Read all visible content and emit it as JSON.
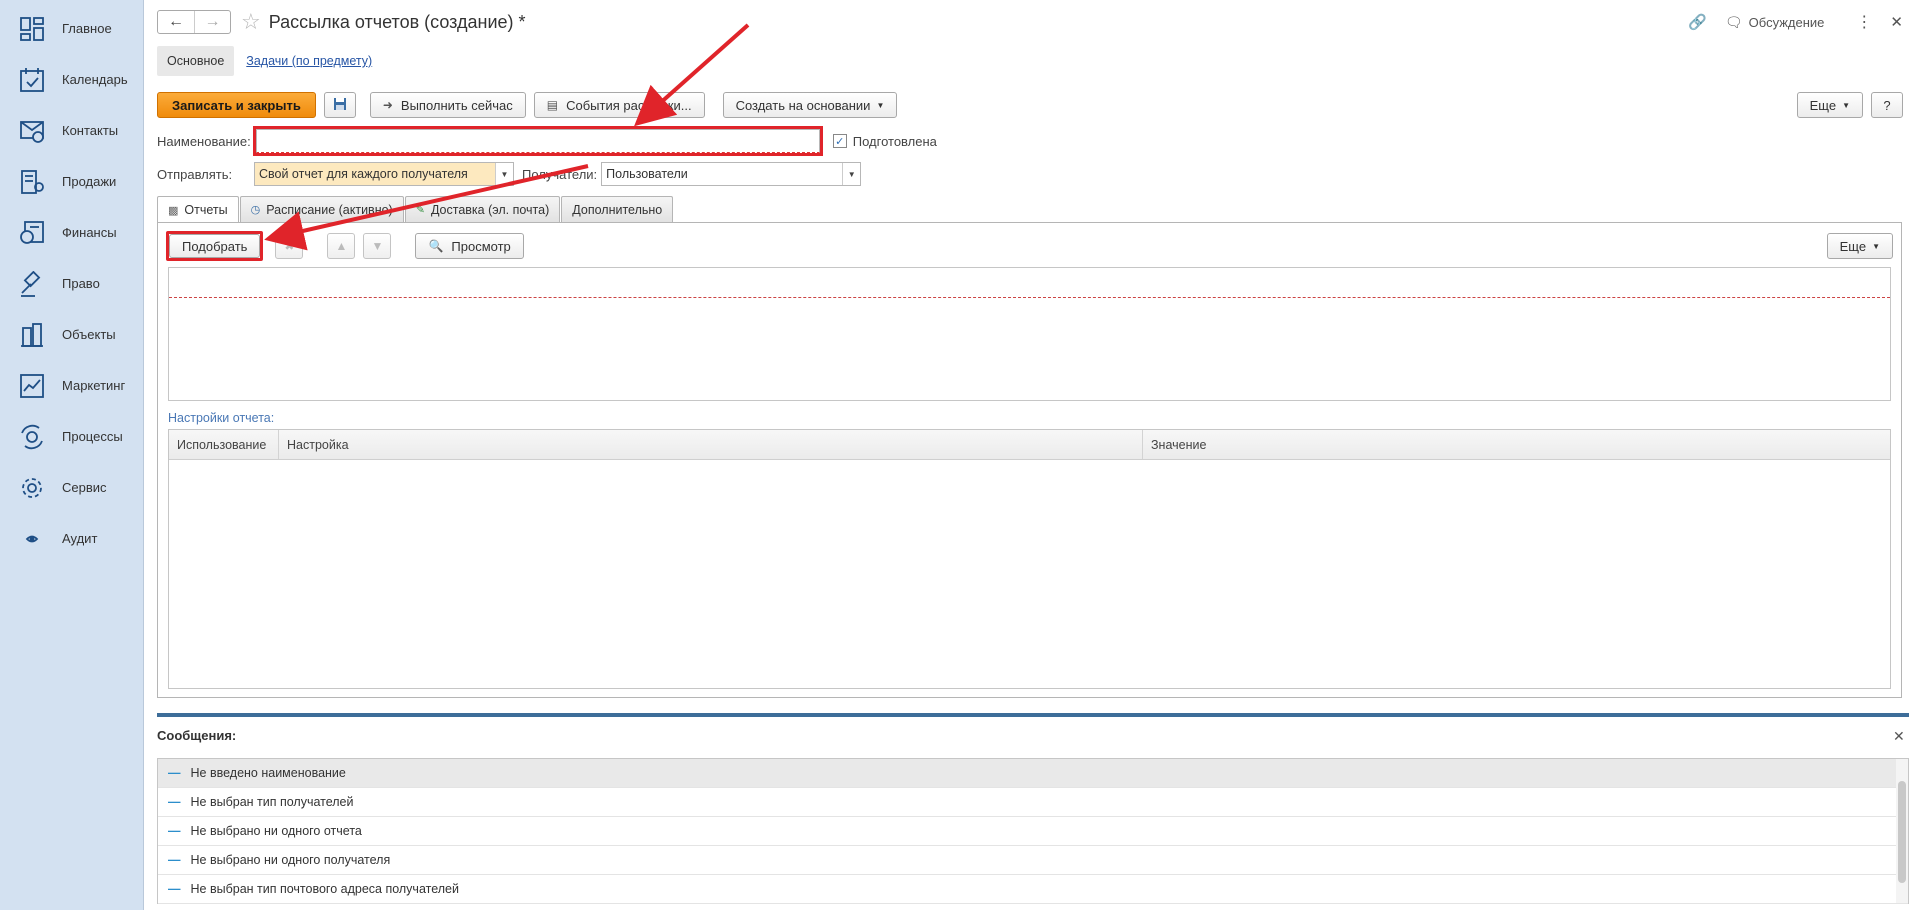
{
  "sidebar": {
    "items": [
      {
        "label": "Главное",
        "icon": "home-grid-icon"
      },
      {
        "label": "Календарь",
        "icon": "calendar-icon"
      },
      {
        "label": "Контакты",
        "icon": "contacts-icon"
      },
      {
        "label": "Продажи",
        "icon": "sales-icon"
      },
      {
        "label": "Финансы",
        "icon": "finance-icon"
      },
      {
        "label": "Право",
        "icon": "law-gavel-icon"
      },
      {
        "label": "Объекты",
        "icon": "buildings-icon"
      },
      {
        "label": "Маркетинг",
        "icon": "chart-icon"
      },
      {
        "label": "Процессы",
        "icon": "process-gears-icon"
      },
      {
        "label": "Сервис",
        "icon": "gear-icon"
      },
      {
        "label": "Аудит",
        "icon": "eye-icon"
      }
    ]
  },
  "header": {
    "title": "Рассылка отчетов (создание) *",
    "discussion": "Обсуждение"
  },
  "formtabs": {
    "main": "Основное",
    "tasks": "Задачи (по предмету)"
  },
  "commands": {
    "save_close": "Записать и закрыть",
    "run_now": "Выполнить сейчас",
    "events": "События рассылки...",
    "create_based": "Создать на основании",
    "more": "Еще",
    "help": "?"
  },
  "form": {
    "name_label": "Наименование:",
    "name_value": "",
    "prepared_label": "Подготовлена",
    "send_label": "Отправлять:",
    "send_value": "Свой отчет для каждого получателя",
    "recipients_label": "Получатели:",
    "recipients_value": "Пользователи"
  },
  "tabs": [
    {
      "label": "Отчеты"
    },
    {
      "label": "Расписание (активно)"
    },
    {
      "label": "Доставка (эл. почта)"
    },
    {
      "label": "Дополнительно"
    }
  ],
  "panel": {
    "pick": "Подобрать",
    "preview": "Просмотр",
    "more": "Еще",
    "settings_label": "Настройки отчета:",
    "columns": [
      "Использование",
      "Настройка",
      "Значение"
    ]
  },
  "messages": {
    "title": "Сообщения:",
    "items": [
      "Не введено наименование",
      "Не выбран тип получателей",
      "Не выбрано ни одного отчета",
      "Не выбрано ни одного получателя",
      "Не выбран тип почтового адреса получателей"
    ]
  },
  "colors": {
    "sidebar_bg": "#d3e1f1",
    "primary_button": "#f08b0b",
    "annotation_red": "#e0242a",
    "splitter": "#3d6d99"
  }
}
